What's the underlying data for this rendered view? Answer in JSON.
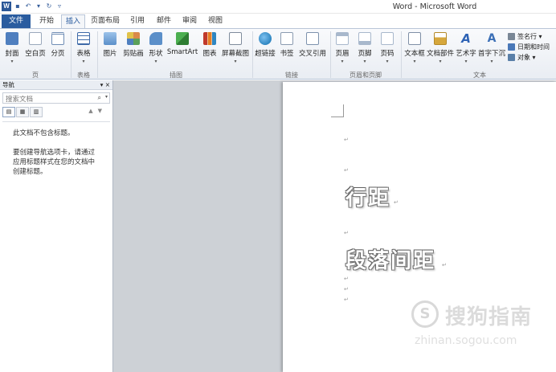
{
  "window": {
    "title": "Word - Microsoft Word",
    "app_logo": "W"
  },
  "quick_access": [
    {
      "icon": "save-icon",
      "glyph": "▪"
    },
    {
      "icon": "undo-icon",
      "glyph": "↶"
    },
    {
      "icon": "dropdown-icon",
      "glyph": "▾"
    },
    {
      "icon": "redo-icon",
      "glyph": "↻"
    },
    {
      "icon": "customize-icon",
      "glyph": "▿"
    }
  ],
  "tabs": [
    {
      "label": "文件",
      "kind": "file"
    },
    {
      "label": "开始"
    },
    {
      "label": "插入",
      "active": true
    },
    {
      "label": "页面布局"
    },
    {
      "label": "引用"
    },
    {
      "label": "邮件"
    },
    {
      "label": "审阅"
    },
    {
      "label": "视图"
    }
  ],
  "ribbon": {
    "groups": [
      {
        "label": "页"
      },
      {
        "label": "表格"
      },
      {
        "label": "插图"
      },
      {
        "label": "链接"
      },
      {
        "label": "页眉和页脚"
      },
      {
        "label": "文本"
      }
    ],
    "buttons": [
      {
        "label": "封面",
        "icon": "cover-page-icon",
        "color": "#4f7fbf"
      },
      {
        "label": "空白页",
        "icon": "blank-page-icon",
        "color": "#9aa8bb"
      },
      {
        "label": "分页",
        "icon": "page-break-icon",
        "color": "#6f8db5"
      },
      {
        "label": "表格",
        "icon": "table-icon",
        "color": "#3e6aa8"
      },
      {
        "label": "图片",
        "icon": "picture-icon",
        "color": "#6b9bd0"
      },
      {
        "label": "剪贴画",
        "icon": "clip-art-icon",
        "color": "#d9894a"
      },
      {
        "label": "形状",
        "icon": "shapes-icon",
        "color": "#5b8fc9"
      },
      {
        "label": "SmartArt",
        "icon": "smartart-icon",
        "color": "#4caf50"
      },
      {
        "label": "图表",
        "icon": "chart-icon",
        "color": "#c0392b"
      },
      {
        "label": "屏幕截图",
        "icon": "screenshot-icon",
        "color": "#7f8c9c"
      },
      {
        "label": "超链接",
        "icon": "hyperlink-icon",
        "color": "#2e86c1"
      },
      {
        "label": "书签",
        "icon": "bookmark-icon",
        "color": "#8a9bb0"
      },
      {
        "label": "交叉引用",
        "icon": "cross-reference-icon",
        "color": "#7d92ad"
      },
      {
        "label": "页眉",
        "icon": "header-icon",
        "color": "#a8b8cc"
      },
      {
        "label": "页脚",
        "icon": "footer-icon",
        "color": "#a8b8cc"
      },
      {
        "label": "页码",
        "icon": "page-number-icon",
        "color": "#a8b8cc"
      },
      {
        "label": "文本框",
        "icon": "text-box-icon",
        "color": "#7f8fa6"
      },
      {
        "label": "文档部件",
        "icon": "quick-parts-icon",
        "color": "#d6a73c"
      },
      {
        "label": "艺术字",
        "icon": "wordart-icon",
        "color": "#2e63b5"
      },
      {
        "label": "首字下沉",
        "icon": "drop-cap-icon",
        "color": "#3b6fb6"
      }
    ],
    "small_buttons": [
      {
        "label": "签名行 ▾",
        "icon": "signature-line-icon",
        "color": "#7a8796"
      },
      {
        "label": "日期和时间",
        "icon": "date-time-icon",
        "color": "#4a78b8"
      },
      {
        "label": "对象 ▾",
        "icon": "object-icon",
        "color": "#5a7fa8"
      }
    ]
  },
  "nav_pane": {
    "title": "导航",
    "controls": "▾ ×",
    "search_placeholder": "搜索文档",
    "search_icon_glyph": "🔍",
    "messages": [
      "此文档不包含标题。",
      "要创建导航选项卡，请通过应用标题样式在您的文档中创建标题。"
    ]
  },
  "document": {
    "headings": [
      "行距",
      "段落间距"
    ],
    "para_mark": "↵"
  },
  "watermark": {
    "logo": "S",
    "text": "搜狗指南",
    "url": "zhinan.sogou.com"
  }
}
